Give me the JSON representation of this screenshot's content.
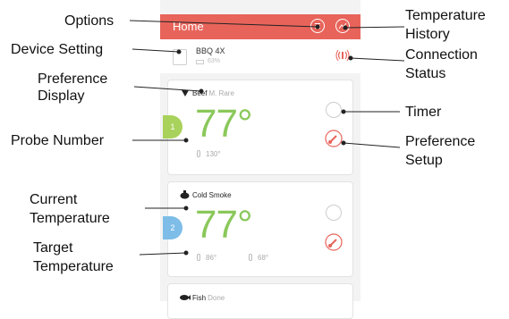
{
  "app": {
    "header_title": "Home",
    "accent": "#e8645b",
    "temp_color": "#8ac85a"
  },
  "device": {
    "name": "BBQ 4X",
    "battery": "63%"
  },
  "probes": [
    {
      "number": "1",
      "food": "Beef",
      "doneness": "M. Rare",
      "temp": "77°",
      "target": "130°",
      "badge_color": "#a8d25c"
    },
    {
      "number": "2",
      "food": "Cold Smoke",
      "doneness": "",
      "temp": "77°",
      "target_low": "86°",
      "target_high": "68°",
      "badge_color": "#7dbde8"
    },
    {
      "food": "Fish",
      "doneness": "Done"
    }
  ],
  "annotations": {
    "options": "Options",
    "device_setting": "Device Setting",
    "preference_display_1": "Preference",
    "preference_display_2": "Display",
    "probe_number": "Probe Number",
    "current_temp_1": "Current",
    "current_temp_2": "Temperature",
    "target_temp_1": "Target",
    "target_temp_2": "Temperature",
    "temp_history_1": "Temperature",
    "temp_history_2": "History",
    "connection_status_1": "Connection",
    "connection_status_2": "Status",
    "timer": "Timer",
    "preference_setup_1": "Preference",
    "preference_setup_2": "Setup"
  }
}
